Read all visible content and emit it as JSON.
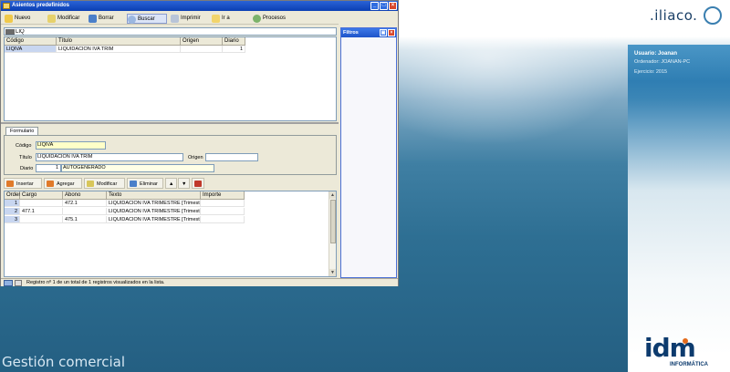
{
  "window": {
    "title": "Asientos predefinidos"
  },
  "toolbar": {
    "nuevo": "Nuevo",
    "modificar": "Modificar",
    "borrar": "Borrar",
    "buscar": "Buscar",
    "imprimir": "Imprimir",
    "ir_a": "Ir a",
    "procesos": "Procesos"
  },
  "search": {
    "value": "LIQ"
  },
  "list": {
    "headers": [
      "Código",
      "Título",
      "Origen",
      "Diario"
    ],
    "rows": [
      {
        "codigo": "LIQIVA",
        "titulo": "LIQUIDACION IVA TRIM",
        "origen": "",
        "diario": "1"
      }
    ]
  },
  "tabs": {
    "formulario": "Formulario"
  },
  "form": {
    "codigo_label": "Código",
    "codigo": "LIQIVA",
    "titulo_label": "Título",
    "titulo": "LIQUIDACION IVA TRIM",
    "origen_label": "Origen",
    "origen": "",
    "diario_label": "Diario",
    "diario_num": "1",
    "diario_name": "AUTOGENERADO"
  },
  "actions": {
    "insertar": "Insertar",
    "agregar": "Agregar",
    "modificar": "Modificar",
    "eliminar": "Eliminar"
  },
  "lines": {
    "headers": [
      "Orden",
      "Cargo",
      "Abono",
      "Texto",
      "Importe"
    ],
    "rows": [
      {
        "orden": "1",
        "cargo": "",
        "abono": "472.1",
        "texto": "LIQUIDACION IVA TRIMESTRE [Trimestr",
        "importe": ""
      },
      {
        "orden": "2",
        "cargo": "477.1",
        "abono": "",
        "texto": "LIQUIDACION IVA TRIMESTRE [Trimestr",
        "importe": ""
      },
      {
        "orden": "3",
        "cargo": "",
        "abono": "475.1",
        "texto": "LIQUIDACION IVA TRIMESTRE [Trimestr",
        "importe": ""
      }
    ]
  },
  "status": {
    "text": "Registro nº 1 de un total de 1 registros visualizados en la lista."
  },
  "filtros": {
    "title": "Filtros"
  },
  "desktop": {
    "brand": ".iliaco.",
    "usuario": "Usuario: Joanan",
    "ordenador": "Ordenador: JOANAN-PC",
    "ejercicio": "Ejercicio: 2015",
    "footer": "Gestión comercial",
    "idm": "idm",
    "idm_sub": "INFORMÁTICA"
  },
  "colors": {
    "accent": "#0b3fb3",
    "brand": "#0d3b6e",
    "selected_field": "#ffffc8"
  }
}
